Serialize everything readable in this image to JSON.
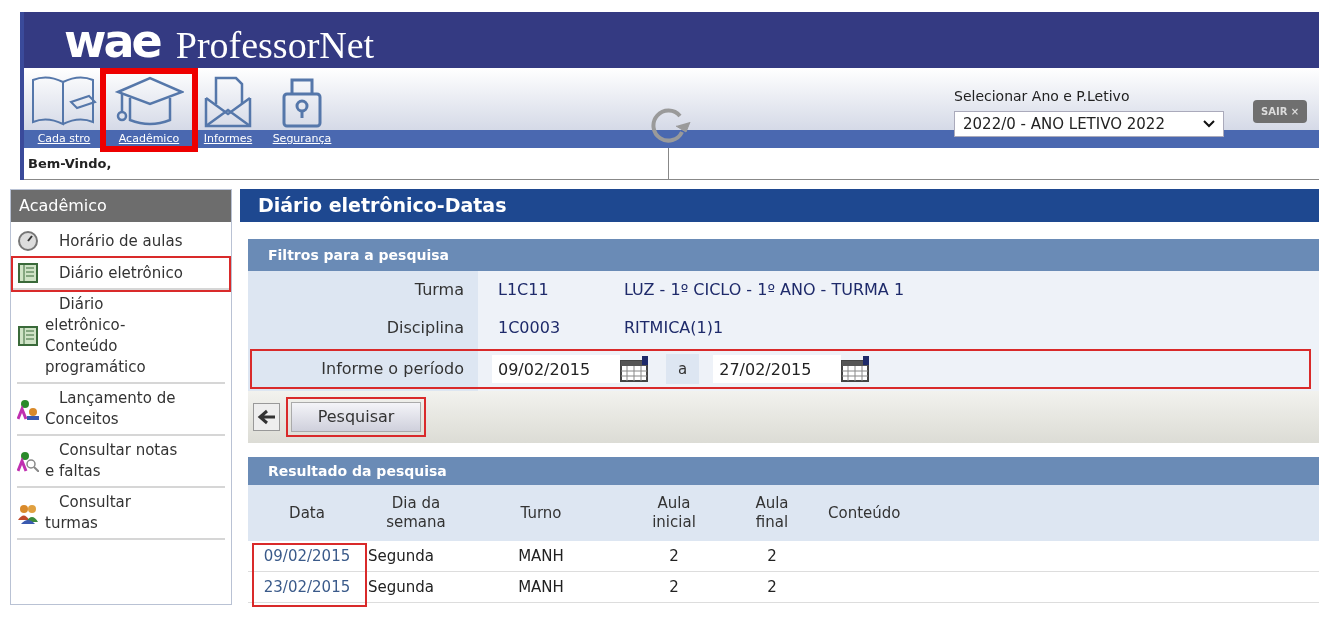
{
  "header": {
    "logo": "wae",
    "title": "ProfessorNet"
  },
  "toolbar": [
    {
      "label": "Cada stro",
      "highlighted": false
    },
    {
      "label": "Acadêmico",
      "highlighted": true
    },
    {
      "label": "Informes",
      "highlighted": false
    },
    {
      "label": "Segurança",
      "highlighted": false
    }
  ],
  "period_selector": {
    "label": "Selecionar Ano e P.Letivo",
    "value": "2022/0 - ANO LETIVO 2022"
  },
  "logout_button": "SAIR ×",
  "welcome": "Bem-Vindo,",
  "sidebar": {
    "title": "Acadêmico",
    "items": [
      {
        "label": "Horário de aulas",
        "highlighted": false
      },
      {
        "label": "Diário eletrônico",
        "highlighted": true
      },
      {
        "label": "Diário eletrônico-Conteúdo programático",
        "highlighted": false
      },
      {
        "label": "Lançamento de Conceitos",
        "highlighted": false
      },
      {
        "label": "Consultar notas e faltas",
        "highlighted": false
      },
      {
        "label": "Consultar turmas",
        "highlighted": false
      }
    ]
  },
  "page_title": "Diário eletrônico-Datas",
  "filters": {
    "title": "Filtros para a pesquisa",
    "rows": [
      {
        "label": "Turma",
        "code": "L1C11",
        "description": "LUZ - 1º CICLO - 1º ANO - TURMA 1"
      },
      {
        "label": "Disciplina",
        "code": "1C0003",
        "description": "RITMICA(1)1"
      }
    ],
    "period": {
      "label": "Informe o período",
      "start": "09/02/2015",
      "separator": "a",
      "end": "27/02/2015",
      "highlighted": true
    }
  },
  "search_button": {
    "label": "Pesquisar",
    "highlighted": true
  },
  "results": {
    "title": "Resultado da pesquisa",
    "date_column_highlighted": true,
    "columns": [
      "Data",
      "Dia da semana",
      "Turno",
      "Aula inicial",
      "Aula final",
      "Conteúdo"
    ],
    "rows": [
      [
        "09/02/2015",
        "Segunda",
        "MANH",
        "2",
        "2"
      ],
      [
        "23/02/2015",
        "Segunda",
        "MANH",
        "2",
        "2"
      ]
    ]
  }
}
